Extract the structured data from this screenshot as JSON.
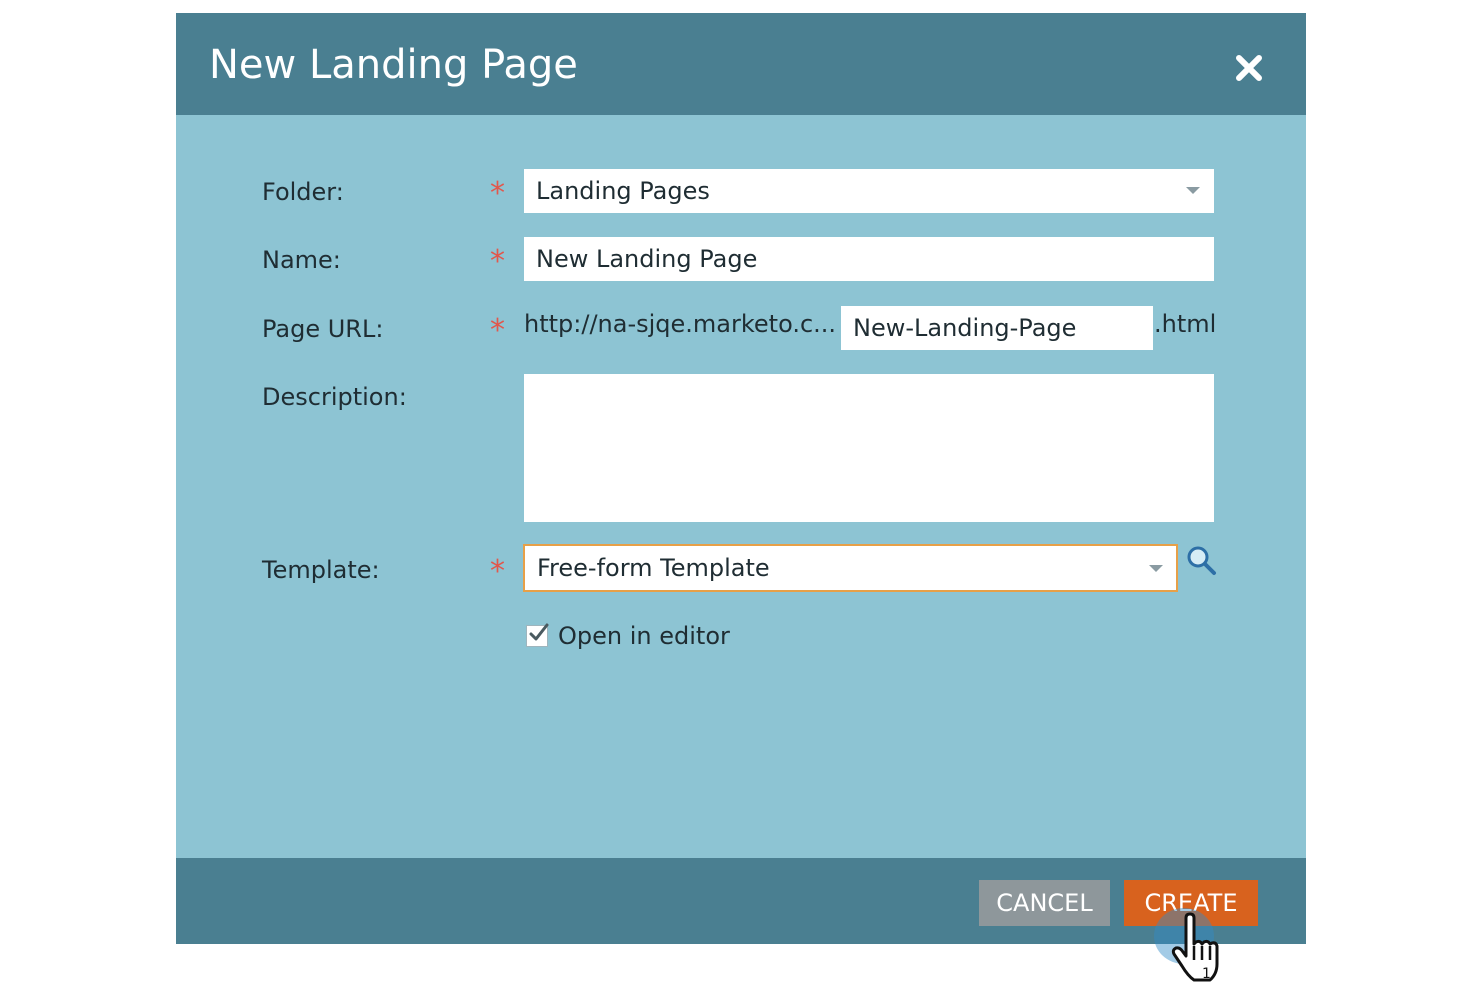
{
  "dialog": {
    "title": "New Landing Page",
    "close_icon": "close-icon"
  },
  "form": {
    "folder": {
      "label": "Folder:",
      "value": "Landing Pages",
      "required_mark": "*"
    },
    "name": {
      "label": "Name:",
      "value": "New Landing Page",
      "required_mark": "*"
    },
    "page_url": {
      "label": "Page URL:",
      "prefix": "http://na-sjqe.marketo.c...",
      "value": "New-Landing-Page",
      "suffix": ".html",
      "required_mark": "*"
    },
    "description": {
      "label": "Description:",
      "value": ""
    },
    "template": {
      "label": "Template:",
      "value": "Free-form Template",
      "required_mark": "*",
      "search_icon": "search-icon"
    },
    "open_in_editor": {
      "label": "Open in editor",
      "checked": true
    }
  },
  "footer": {
    "cancel_label": "CANCEL",
    "create_label": "CREATE"
  },
  "colors": {
    "header_footer": "#4a7f91",
    "body": "#8dc4d3",
    "required": "#e2574c",
    "create_button": "#d8621e",
    "cancel_button": "#8e979b",
    "template_border": "#e7a048"
  }
}
